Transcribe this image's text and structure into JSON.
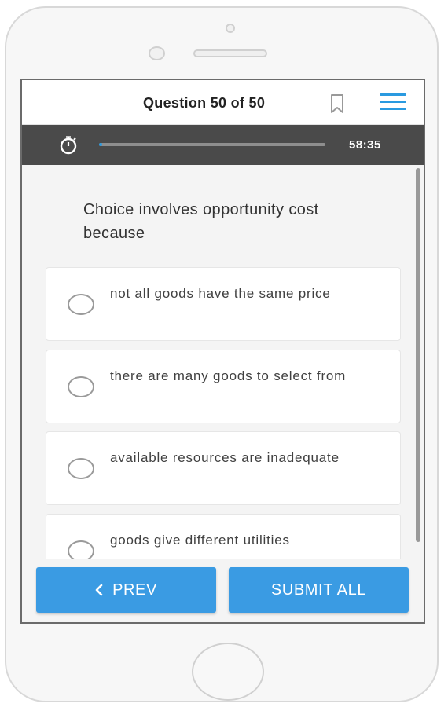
{
  "header": {
    "question_counter": "Question 50 of 50",
    "bookmark_icon": "bookmark-outline-icon",
    "menu_icon": "hamburger-menu-icon"
  },
  "timer": {
    "icon": "stopwatch-icon",
    "progress_fraction": 0.01,
    "remaining": "58:35"
  },
  "question": {
    "text": "Choice involves opportunity cost because"
  },
  "options": [
    {
      "text": " not all goods have the same price",
      "selected": false
    },
    {
      "text": "there are many goods to select from",
      "selected": false
    },
    {
      "text": "available resources are inadequate",
      "selected": false
    },
    {
      "text": "goods give different utilities",
      "selected": false
    }
  ],
  "footer": {
    "prev_label": "PREV",
    "prev_icon": "chevron-left-icon",
    "submit_label": "SUBMIT ALL"
  },
  "colors": {
    "accent": "#3a9be3",
    "timer_bar": "#4a4a4a",
    "background": "#f4f4f4"
  }
}
